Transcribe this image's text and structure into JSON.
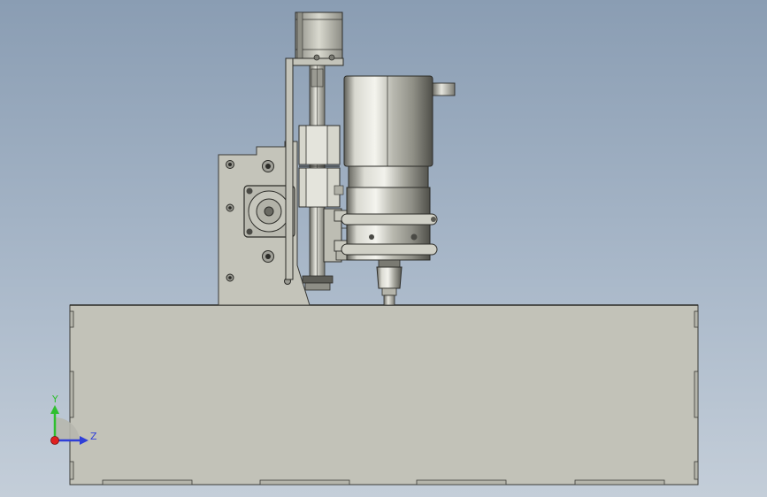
{
  "triad": {
    "y_label": "Y",
    "z_label": "Z",
    "y_color": "#2fbf2f",
    "z_color": "#2f3fd8",
    "x_color": "#e02020"
  },
  "colors": {
    "background_top": "#8a9db3",
    "background_bottom": "#c4ced9",
    "base": "#c2c2b8",
    "plate": "#c4c4ba",
    "spindle_light": "#f0f0e8",
    "spindle_dark": "#6e6e66",
    "outline": "#3a3a36"
  }
}
